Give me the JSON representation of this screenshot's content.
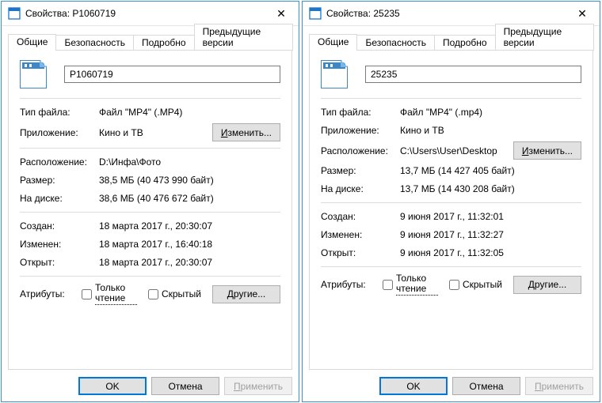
{
  "dialogs": [
    {
      "title": "Свойства: P1060719",
      "close": "✕",
      "tabs": [
        "Общие",
        "Безопасность",
        "Подробно",
        "Предыдущие версии"
      ],
      "activeTab": 0,
      "filename": "P1060719",
      "rows": {
        "filetype_lbl": "Тип файла:",
        "filetype_val": "Файл \"MP4\" (.MP4)",
        "app_lbl": "Приложение:",
        "app_val": "Кино и ТВ",
        "change_btn": "Изменить...",
        "loc_lbl": "Расположение:",
        "loc_val": "D:\\Инфа\\Фото",
        "size_lbl": "Размер:",
        "size_val": "38,5 МБ (40 473 990 байт)",
        "disk_lbl": "На диске:",
        "disk_val": "38,6 МБ (40 476 672 байт)",
        "created_lbl": "Создан:",
        "created_val": "18 марта 2017 г., 20:30:07",
        "modified_lbl": "Изменен:",
        "modified_val": "18 марта 2017 г., 16:40:18",
        "accessed_lbl": "Открыт:",
        "accessed_val": "18 марта 2017 г., 20:30:07",
        "attr_lbl": "Атрибуты:",
        "attr_readonly": "Только чтение",
        "attr_hidden": "Скрытый",
        "other_btn": "Другие..."
      },
      "footer": {
        "ok": "OK",
        "cancel": "Отмена",
        "apply": "Применить"
      }
    },
    {
      "title": "Свойства: 25235",
      "close": "✕",
      "tabs": [
        "Общие",
        "Безопасность",
        "Подробно",
        "Предыдущие версии"
      ],
      "activeTab": 0,
      "filename": "25235",
      "rows": {
        "filetype_lbl": "Тип файла:",
        "filetype_val": "Файл \"MP4\" (.mp4)",
        "app_lbl": "Приложение:",
        "app_val": "Кино и ТВ",
        "change_btn": "Изменить...",
        "loc_lbl": "Расположение:",
        "loc_val": "C:\\Users\\User\\Desktop",
        "size_lbl": "Размер:",
        "size_val": "13,7 МБ (14 427 405 байт)",
        "disk_lbl": "На диске:",
        "disk_val": "13,7 МБ (14 430 208 байт)",
        "created_lbl": "Создан:",
        "created_val": "9 июня 2017 г., 11:32:01",
        "modified_lbl": "Изменен:",
        "modified_val": "9 июня 2017 г., 11:32:27",
        "accessed_lbl": "Открыт:",
        "accessed_val": "9 июня 2017 г., 11:32:05",
        "attr_lbl": "Атрибуты:",
        "attr_readonly": "Только чтение",
        "attr_hidden": "Скрытый",
        "other_btn": "Другие..."
      },
      "footer": {
        "ok": "OK",
        "cancel": "Отмена",
        "apply": "Применить"
      }
    }
  ]
}
